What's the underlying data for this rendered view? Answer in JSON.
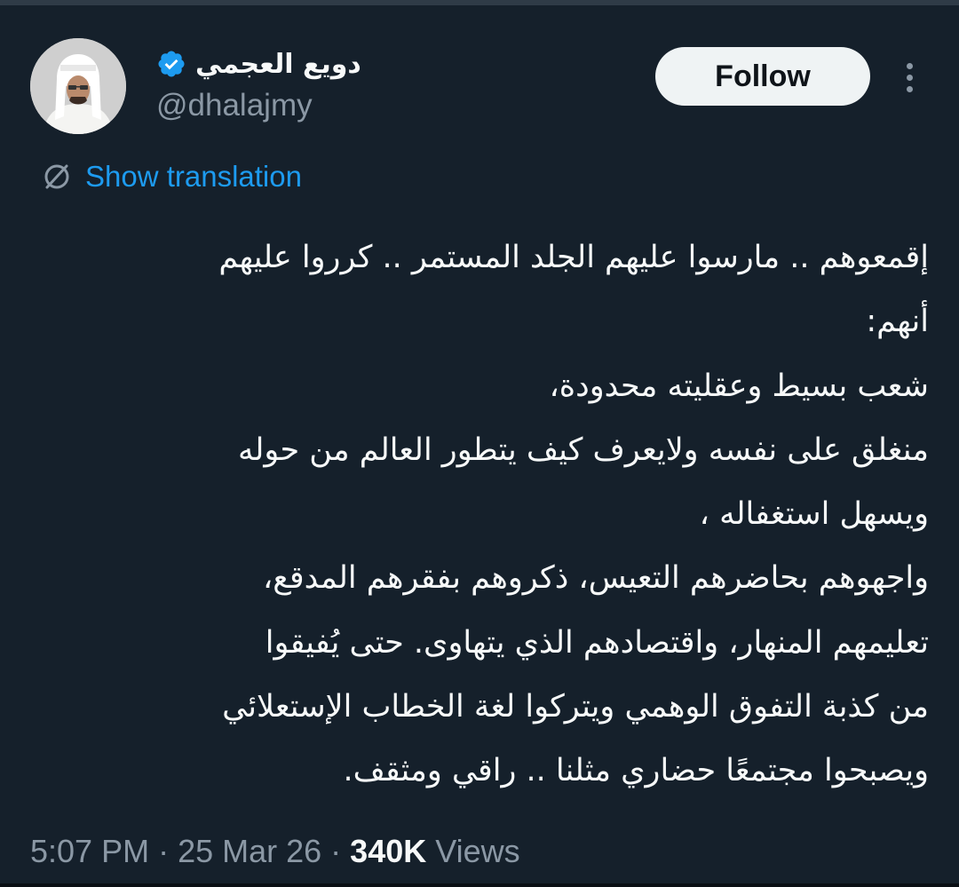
{
  "author": {
    "display_name": "دويع العجمي",
    "handle": "@dhalajmy",
    "verified": true,
    "avatar_icon": "profile-photo"
  },
  "actions": {
    "follow_label": "Follow",
    "more_icon": "more-vertical-icon"
  },
  "translation": {
    "label": "Show translation",
    "icon": "globe-translate-icon"
  },
  "tweet": {
    "lines": [
      "إقمعوهم .. مارسوا عليهم الجلد المستمر .. كرروا عليهم",
      "أنهم:",
      "شعب بسيط وعقليته محدودة،",
      "منغلق على نفسه ولايعرف كيف يتطور العالم من حوله",
      "ويسهل استغفاله ،",
      "واجهوهم بحاضرهم التعيس، ذكروهم بفقرهم المدقع،",
      "تعليمهم المنهار، واقتصادهم الذي يتهاوى. حتى يُفيقوا",
      "من كذبة التفوق الوهمي ويتركوا لغة الخطاب الإستعلائي",
      "ويصبحوا مجتمعًا حضاري مثلنا .. راقي ومثقف."
    ]
  },
  "meta": {
    "time": "5:07 PM",
    "separator": " · ",
    "date": "25 Mar 26",
    "views_count": "340K",
    "views_label": " Views"
  },
  "colors": {
    "background": "#15202b",
    "text": "#f7f9f9",
    "secondary": "#8b98a5",
    "accent": "#1d9bf0",
    "button_bg": "#eff3f4"
  }
}
